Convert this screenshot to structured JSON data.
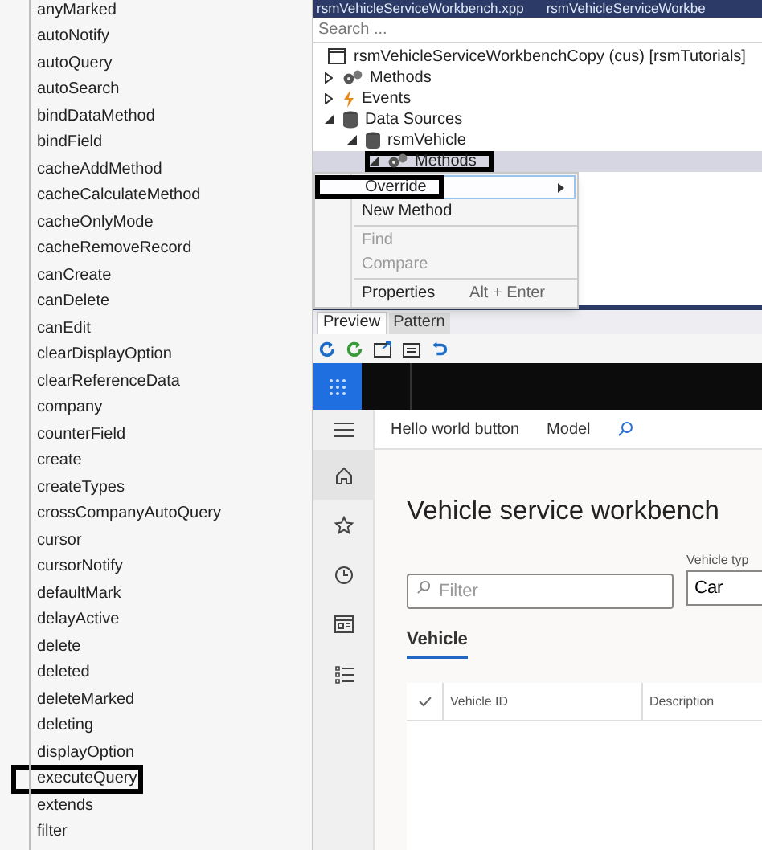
{
  "method_list": {
    "items": [
      {
        "label": "anyMarked",
        "highlighted": false
      },
      {
        "label": "autoNotify",
        "highlighted": false
      },
      {
        "label": "autoQuery",
        "highlighted": false
      },
      {
        "label": "autoSearch",
        "highlighted": false
      },
      {
        "label": "bindDataMethod",
        "highlighted": false
      },
      {
        "label": "bindField",
        "highlighted": false
      },
      {
        "label": "cacheAddMethod",
        "highlighted": false
      },
      {
        "label": "cacheCalculateMethod",
        "highlighted": false
      },
      {
        "label": "cacheOnlyMode",
        "highlighted": false
      },
      {
        "label": "cacheRemoveRecord",
        "highlighted": false
      },
      {
        "label": "canCreate",
        "highlighted": false
      },
      {
        "label": "canDelete",
        "highlighted": false
      },
      {
        "label": "canEdit",
        "highlighted": false
      },
      {
        "label": "clearDisplayOption",
        "highlighted": false
      },
      {
        "label": "clearReferenceData",
        "highlighted": false
      },
      {
        "label": "company",
        "highlighted": false
      },
      {
        "label": "counterField",
        "highlighted": false
      },
      {
        "label": "create",
        "highlighted": false
      },
      {
        "label": "createTypes",
        "highlighted": false
      },
      {
        "label": "crossCompanyAutoQuery",
        "highlighted": false
      },
      {
        "label": "cursor",
        "highlighted": false
      },
      {
        "label": "cursorNotify",
        "highlighted": false
      },
      {
        "label": "defaultMark",
        "highlighted": false
      },
      {
        "label": "delayActive",
        "highlighted": false
      },
      {
        "label": "delete",
        "highlighted": false
      },
      {
        "label": "deleted",
        "highlighted": false
      },
      {
        "label": "deleteMarked",
        "highlighted": false
      },
      {
        "label": "deleting",
        "highlighted": false
      },
      {
        "label": "displayOption",
        "highlighted": false
      },
      {
        "label": "executeQuery",
        "highlighted": true
      },
      {
        "label": "extends",
        "highlighted": false
      },
      {
        "label": "filter",
        "highlighted": false
      }
    ]
  },
  "editor_tabs": [
    "rsmVehicleServiceWorkbench.xpp",
    "rsmVehicleServiceWorkbe"
  ],
  "search": {
    "placeholder": "Search ..."
  },
  "tree": {
    "root": "rsmVehicleServiceWorkbenchCopy (cus) [rsmTutorials]",
    "items": [
      {
        "label": "Methods",
        "kind": "methods",
        "expanded": false,
        "selected": false,
        "highlighted": false
      },
      {
        "label": "Events",
        "kind": "events",
        "expanded": false,
        "selected": false,
        "highlighted": false
      },
      {
        "label": "Data Sources",
        "kind": "datasource",
        "expanded": true,
        "selected": false,
        "highlighted": false,
        "children": [
          {
            "label": "rsmVehicle",
            "kind": "datasource",
            "expanded": true,
            "selected": false,
            "highlighted": false,
            "children": [
              {
                "label": "Methods",
                "kind": "methods",
                "expanded": true,
                "selected": true,
                "highlighted": true
              }
            ]
          }
        ]
      }
    ]
  },
  "context_menu": {
    "items": [
      {
        "kind": "item",
        "label": "Override",
        "submenu": true,
        "hovered": true,
        "disabled": false,
        "highlighted": true
      },
      {
        "kind": "item",
        "label": "New Method",
        "submenu": false,
        "hovered": false,
        "disabled": false,
        "highlighted": false
      },
      {
        "kind": "separator"
      },
      {
        "kind": "item",
        "label": "Find",
        "submenu": false,
        "hovered": false,
        "disabled": true,
        "highlighted": false
      },
      {
        "kind": "item",
        "label": "Compare",
        "submenu": false,
        "hovered": false,
        "disabled": true,
        "highlighted": false
      },
      {
        "kind": "separator"
      },
      {
        "kind": "item",
        "label": "Properties",
        "shortcut": "Alt + Enter",
        "submenu": false,
        "hovered": false,
        "disabled": false,
        "highlighted": false
      }
    ]
  },
  "pane_tabs": [
    {
      "label": "Preview",
      "selected": true
    },
    {
      "label": "Pattern",
      "selected": false
    }
  ],
  "app": {
    "nav": [
      {
        "kind": "menu",
        "selected": false
      },
      {
        "kind": "home",
        "selected": true
      },
      {
        "kind": "favorites",
        "selected": false
      },
      {
        "kind": "recent",
        "selected": false
      },
      {
        "kind": "workspaces",
        "selected": false
      },
      {
        "kind": "modules",
        "selected": false
      }
    ],
    "action_bar": [
      "Hello world button",
      "Model"
    ],
    "page_title": "Vehicle service workbench",
    "filter": {
      "placeholder": "Filter"
    },
    "vehicle_type": {
      "label": "Vehicle typ",
      "value": "Car"
    },
    "tabs": [
      {
        "label": "Vehicle",
        "selected": true
      }
    ],
    "grid": {
      "columns": [
        "Vehicle ID",
        "Description"
      ]
    }
  }
}
